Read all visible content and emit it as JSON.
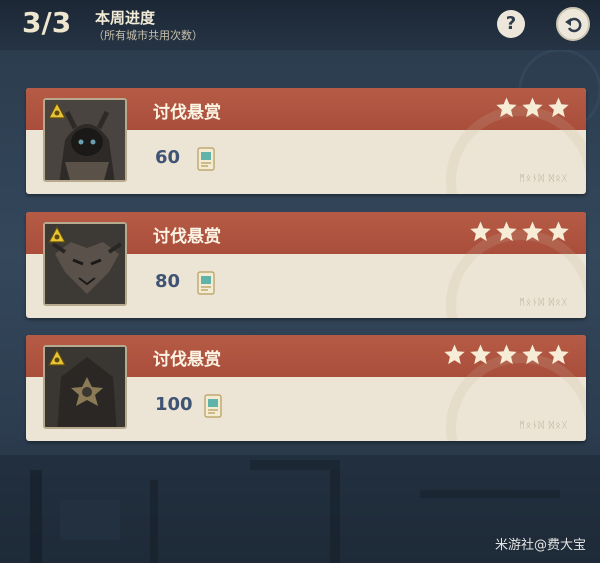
{
  "header": {
    "progress": "3/3",
    "title": "本周进度",
    "subtitle": "（所有城市共用次数）",
    "help_icon": "question-icon",
    "back_icon": "return-arrow-icon"
  },
  "cards": [
    {
      "title": "讨伐悬赏",
      "stars": 3,
      "reward": "60",
      "reward_icon": "bounty-scroll-icon"
    },
    {
      "title": "讨伐悬赏",
      "stars": 4,
      "reward": "80",
      "reward_icon": "bounty-scroll-icon"
    },
    {
      "title": "讨伐悬赏",
      "stars": 5,
      "reward": "100",
      "reward_icon": "bounty-scroll-icon"
    }
  ],
  "watermark": "米游社@费大宝",
  "colors": {
    "band": "#b0543f",
    "card": "#ece4d4",
    "star": "#f7ecd6",
    "reward_text": "#3f5474",
    "background": "#2b3b4d"
  }
}
